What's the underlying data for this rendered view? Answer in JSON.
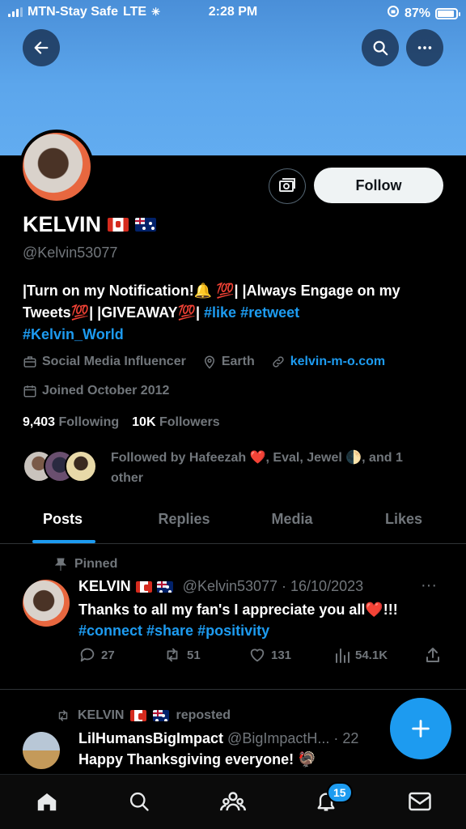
{
  "status_bar": {
    "carrier": "MTN-Stay Safe",
    "network": "LTE",
    "time": "2:28 PM",
    "battery": "87%",
    "signal_bars": 3
  },
  "profile": {
    "name": "KELVIN",
    "handle": "@Kelvin53077",
    "follow_label": "Follow",
    "bio": {
      "part1": "|Turn on my Notification!🔔 💯| |Always Engage on my Tweets💯| |GIVEAWAY💯| ",
      "tag1": "#like",
      "tag2": "#retweet",
      "tag3": "#Kelvin_World"
    },
    "category": "Social Media Influencer",
    "location": "Earth",
    "website": "kelvin-m-o.com",
    "joined": "Joined October 2012",
    "following_count": "9,403",
    "following_label": "Following",
    "followers_count": "10K",
    "followers_label": "Followers",
    "followed_by": "Followed by Hafeezah ❤️, Eval, Jewel 🌓, and 1 other"
  },
  "tabs": [
    "Posts",
    "Replies",
    "Media",
    "Likes"
  ],
  "pinned_tweet": {
    "pinned_label": "Pinned",
    "author": "KELVIN",
    "handle_date": "@Kelvin53077 · 16/10/2023",
    "text": "Thanks to all my fan's I appreciate you all❤️!!!",
    "hashtags": "#connect #share #positivity",
    "replies": "27",
    "reposts": "51",
    "likes": "131",
    "views": "54.1K"
  },
  "second_tweet": {
    "repost_label": "reposted",
    "reposter": "KELVIN",
    "author": "LilHumansBigImpact",
    "handle": "@BigImpactH... · 22",
    "text": "Happy Thanksgiving everyone! 🦃"
  },
  "bottom_nav": {
    "notifications_badge": "15"
  },
  "colors": {
    "accent": "#1d9bf0",
    "banner": "#5ca6ec",
    "background": "#000000"
  }
}
